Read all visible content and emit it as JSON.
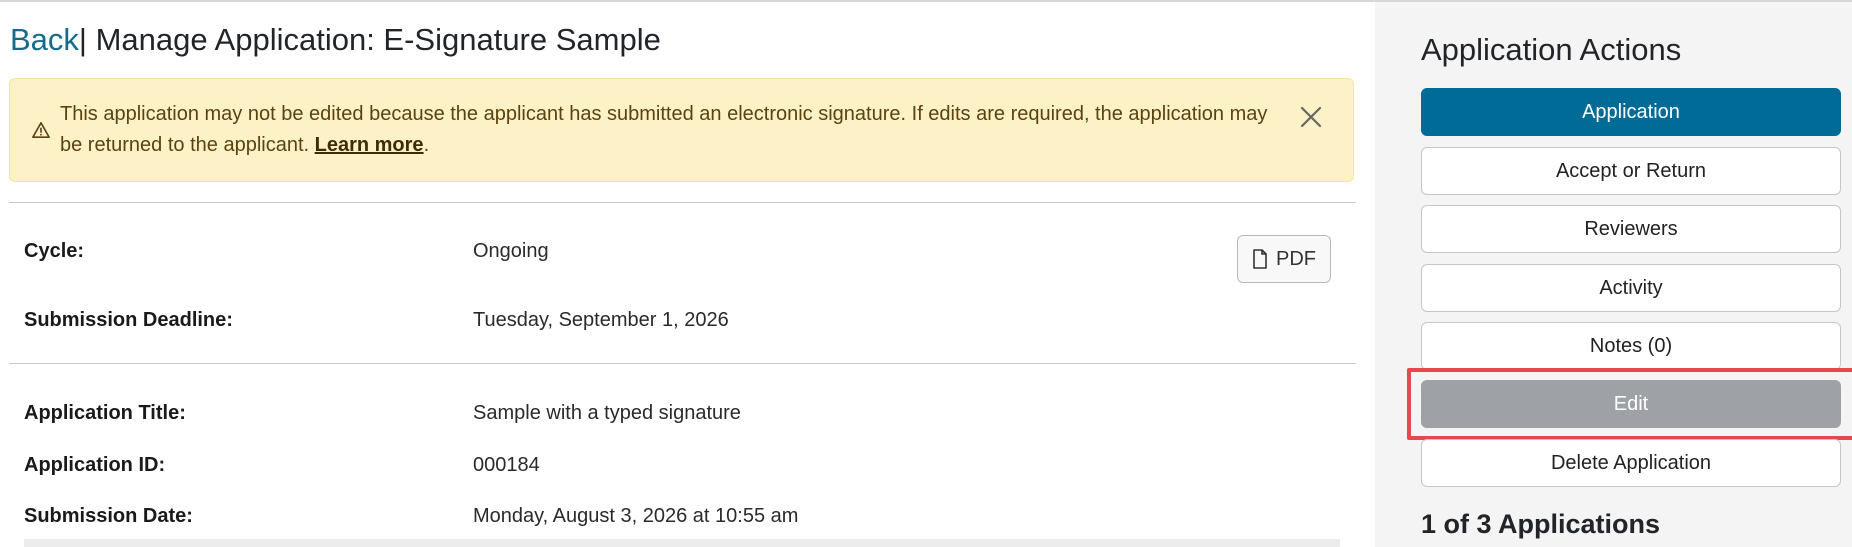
{
  "header": {
    "back_label": "Back",
    "separator": "|",
    "title": "Manage Application: E-Signature Sample"
  },
  "alert": {
    "icon": "warning-triangle-icon",
    "text": "This application may not be edited because the applicant has submitted an electronic signature. If edits are required, the application may be returned to the applicant.",
    "link_label": "Learn more",
    "link_suffix": ".",
    "close_icon": "close-icon"
  },
  "details": {
    "cycle_label": "Cycle:",
    "cycle_value": "Ongoing",
    "deadline_label": "Submission Deadline:",
    "deadline_value": "Tuesday, September 1, 2026",
    "pdf_label": "PDF",
    "app_title_label": "Application Title:",
    "app_title_value": "Sample with a typed signature",
    "app_id_label": "Application ID:",
    "app_id_value": "000184",
    "submission_date_label": "Submission Date:",
    "submission_date_value": "Monday, August 3, 2026 at 10:55 am"
  },
  "sidebar": {
    "title": "Application Actions",
    "buttons": [
      {
        "label": "Application",
        "state": "active"
      },
      {
        "label": "Accept or Return",
        "state": "normal"
      },
      {
        "label": "Reviewers",
        "state": "normal"
      },
      {
        "label": "Activity",
        "state": "normal"
      },
      {
        "label": "Notes (0)",
        "state": "normal"
      },
      {
        "label": "Edit",
        "state": "disabled"
      },
      {
        "label": "Delete Application",
        "state": "normal"
      }
    ],
    "footer": "1 of 3 Applications"
  },
  "colors": {
    "primary": "#006b96",
    "link": "#156b8a",
    "alert_bg": "#fdf1c7",
    "disabled": "#9ea2a6",
    "highlight": "#e5484d"
  }
}
